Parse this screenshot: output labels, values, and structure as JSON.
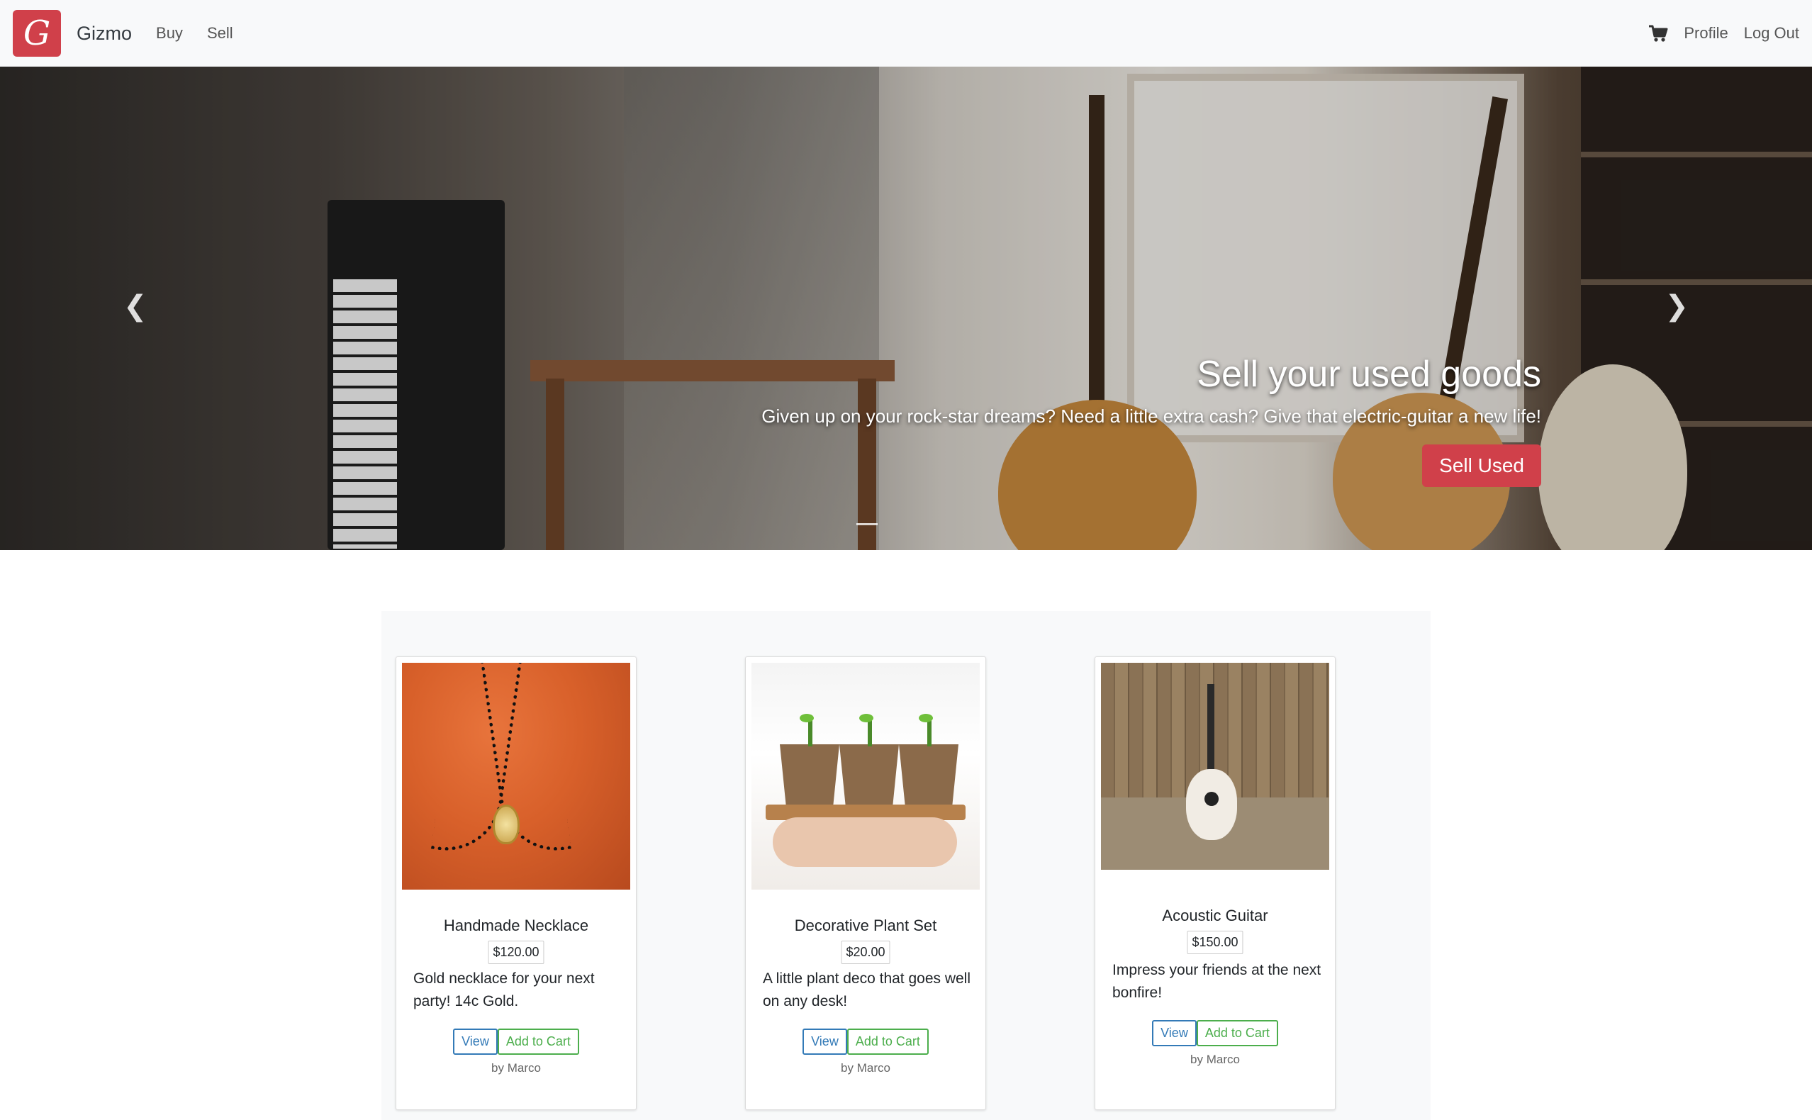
{
  "navbar": {
    "logo_letter": "G",
    "brand": "Gizmo",
    "links": [
      "Buy",
      "Sell"
    ],
    "right_links": [
      "Profile",
      "Log Out"
    ],
    "cart_icon": "cart-icon"
  },
  "hero": {
    "heading": "Sell your used goods",
    "subheading": "Given up on your rock-star dreams? Need a little extra cash? Give that electric-guitar a new life!",
    "button_label": "Sell Used",
    "prev_icon": "chevron-left-icon",
    "next_icon": "chevron-right-icon",
    "accent": "#d0404a"
  },
  "products": [
    {
      "title": "Handmade Necklace",
      "price": "$120.00",
      "description": "Gold necklace for your next party! 14c Gold.",
      "view_label": "View",
      "cart_label": "Add to Cart",
      "seller": "by Marco"
    },
    {
      "title": "Decorative Plant Set",
      "price": "$20.00",
      "description": "A little plant deco that goes well on any desk!",
      "view_label": "View",
      "cart_label": "Add to Cart",
      "seller": "by Marco"
    },
    {
      "title": "Acoustic Guitar",
      "price": "$150.00",
      "description": "Impress your friends at the next bonfire!",
      "view_label": "View",
      "cart_label": "Add to Cart",
      "seller": "by Marco"
    }
  ]
}
